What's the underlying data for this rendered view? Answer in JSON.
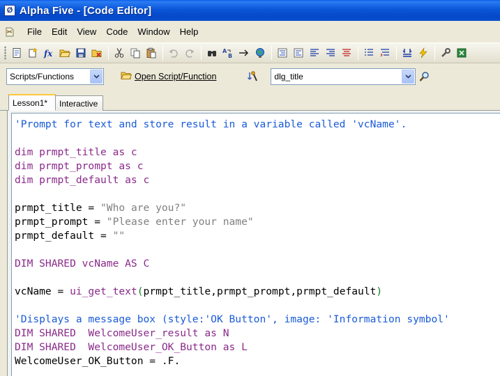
{
  "window": {
    "title": "Alpha Five - [Code Editor]",
    "app_icon_letter": "Ø"
  },
  "menu": [
    "File",
    "Edit",
    "View",
    "Code",
    "Window",
    "Help"
  ],
  "toolbar": {
    "icons": [
      "new-icon",
      "new-wizard-icon",
      "function-icon",
      "open-icon",
      "save-icon",
      "close-icon",
      "cut-icon",
      "copy-icon",
      "paste-icon",
      "undo-icon",
      "redo-icon",
      "find-icon",
      "replace-icon",
      "goto-icon",
      "globe-icon",
      "indent-icon",
      "outdent-icon",
      "align-left-icon",
      "align-right-icon",
      "align-center-icon",
      "list-icon",
      "list2-icon",
      "step-icon",
      "run-icon",
      "tools-icon",
      "excel-icon"
    ]
  },
  "scriptbar": {
    "category": "Scripts/Functions",
    "open_label": "Open Script/Function",
    "script_name": "dlg_title"
  },
  "tabs": [
    {
      "label": "Lesson1*",
      "active": true
    },
    {
      "label": "Interactive",
      "active": false
    }
  ],
  "code": {
    "lines": [
      [
        {
          "t": "'Prompt for text and store result in a variable called 'vcName'.",
          "c": "comment"
        }
      ],
      [
        {
          "t": "",
          "c": "plain"
        }
      ],
      [
        {
          "t": "dim prmpt_title as c",
          "c": "dim"
        }
      ],
      [
        {
          "t": "dim prmpt_prompt as c",
          "c": "dim"
        }
      ],
      [
        {
          "t": "dim prmpt_default as c",
          "c": "dim"
        }
      ],
      [
        {
          "t": "",
          "c": "plain"
        }
      ],
      [
        {
          "t": "prmpt_title = ",
          "c": "plain"
        },
        {
          "t": "\"Who are you?\"",
          "c": "str"
        }
      ],
      [
        {
          "t": "prmpt_prompt = ",
          "c": "plain"
        },
        {
          "t": "\"Please enter your name\"",
          "c": "str"
        }
      ],
      [
        {
          "t": "prmpt_default = ",
          "c": "plain"
        },
        {
          "t": "\"\"",
          "c": "str"
        }
      ],
      [
        {
          "t": "",
          "c": "plain"
        }
      ],
      [
        {
          "t": "DIM SHARED vcName AS C",
          "c": "dim"
        }
      ],
      [
        {
          "t": "",
          "c": "plain"
        }
      ],
      [
        {
          "t": "vcName = ",
          "c": "plain"
        },
        {
          "t": "ui_get_text",
          "c": "func"
        },
        {
          "t": "(",
          "c": "paren"
        },
        {
          "t": "prmpt_title,prmpt_prompt,prmpt_default",
          "c": "plain"
        },
        {
          "t": ")",
          "c": "paren"
        }
      ],
      [
        {
          "t": "",
          "c": "plain"
        }
      ],
      [
        {
          "t": "'Displays a message box (style:'OK Button', image: 'Information symbol'",
          "c": "comment"
        }
      ],
      [
        {
          "t": "DIM SHARED  WelcomeUser_result as N",
          "c": "dim"
        }
      ],
      [
        {
          "t": "DIM SHARED  WelcomeUser_OK_Button as L",
          "c": "dim"
        }
      ],
      [
        {
          "t": "WelcomeUser_OK_Button = .F.",
          "c": "plain"
        }
      ]
    ]
  }
}
